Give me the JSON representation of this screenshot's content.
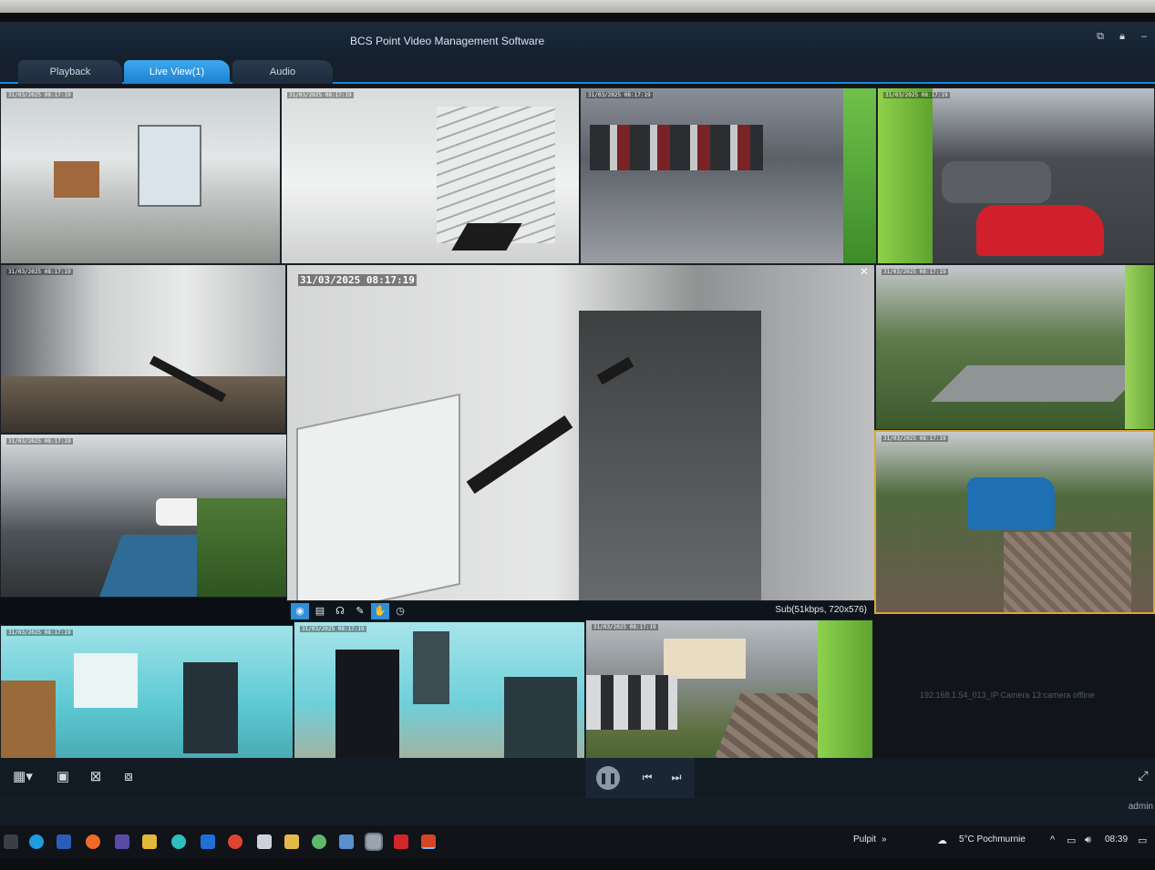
{
  "app": {
    "title": "BCS Point Video Management Software"
  },
  "tabs": [
    {
      "label": "Playback"
    },
    {
      "label": "Live View(1)"
    },
    {
      "label": "Audio"
    }
  ],
  "cameras": {
    "main_timestamp": "31/03/2025 08:17:19",
    "small_timestamp": "31/03/2025 08:17:19",
    "stream_info": "Sub(51kbps, 720x576)",
    "offline_message": "192.168.1.54_013_IP Camera 13:camera offline"
  },
  "taskbar": {
    "desktop_label": "Pulpit",
    "chevron": "»",
    "weather": "5°C Pochmurnie",
    "time": "08:39"
  },
  "status": {
    "user": "admin"
  },
  "colors": {
    "accent": "#1e88d8",
    "selected_border": "#d8a63a"
  }
}
